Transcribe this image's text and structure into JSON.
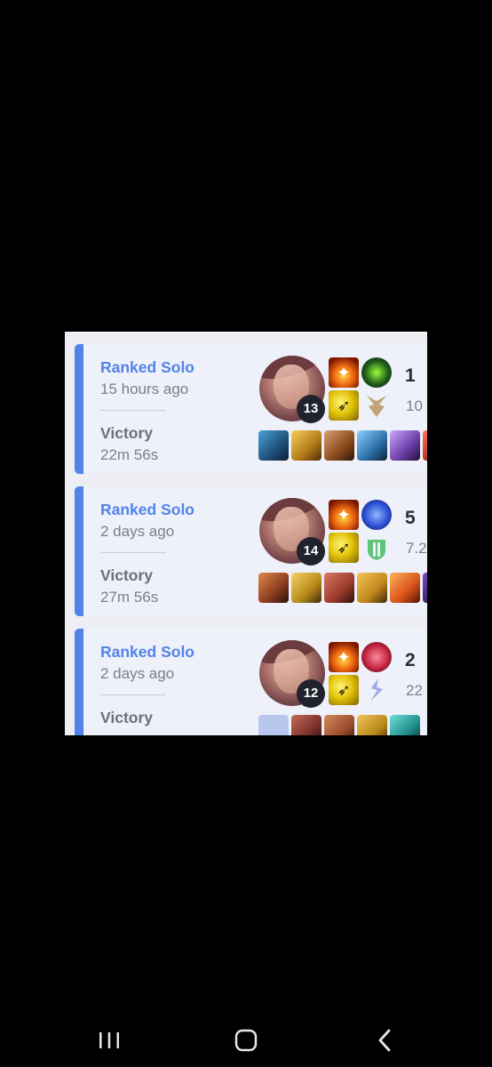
{
  "matches": [
    {
      "queue": "Ranked Solo",
      "time_ago": "15 hours ago",
      "result": "Victory",
      "duration": "22m 56s",
      "champion_level": "13",
      "kda_partial": "1",
      "sub_partial": "10",
      "runes": {
        "primary": "green-precision-icon",
        "secondary": "tan-shard-icon",
        "primary_color": "#1d5a1a",
        "secondary_color": "#c2a47a"
      },
      "items": [
        "#1f4f7a",
        "#b27a1a",
        "#8a4a1c",
        "#2c6fa8",
        "#6b3ea8",
        "#b22a1a"
      ]
    },
    {
      "queue": "Ranked Solo",
      "time_ago": "2 days ago",
      "result": "Victory",
      "duration": "27m 56s",
      "champion_level": "14",
      "kda_partial": "5",
      "sub_partial": "7.2",
      "runes": {
        "primary": "blue-arcane-icon",
        "secondary": "green-resolve-icon",
        "primary_color": "#2b4fd6",
        "secondary_color": "#5fc47a"
      },
      "items": [
        "#8a3c1e",
        "#b8891a",
        "#9c3a2c",
        "#c2881c",
        "#d8521a",
        "#3a2060"
      ]
    },
    {
      "queue": "Ranked Solo",
      "time_ago": "2 days ago",
      "result": "Victory",
      "duration": "",
      "champion_level": "12",
      "kda_partial": "2",
      "sub_partial": "22",
      "runes": {
        "primary": "red-domination-icon",
        "secondary": "lavender-sorcery-icon",
        "primary_color": "#c4243f",
        "secondary_color": "#9aa8e8"
      },
      "items": [
        "#b7c7ee",
        "#7a2f2a",
        "#9a4a2c",
        "#b8881a",
        "#1e8a88"
      ]
    }
  ],
  "accent_color": "#5383e8",
  "navbar": {
    "recents": "recent-apps-icon",
    "home": "home-icon",
    "back": "back-icon"
  }
}
